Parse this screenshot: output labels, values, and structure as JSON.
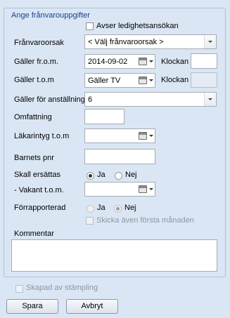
{
  "group_title": "Ange frånvarouppgifter",
  "avser_ledighet": {
    "label": "Avser ledighetsansökan",
    "checked": false
  },
  "franvaroorsak": {
    "label": "Frånvaroorsak",
    "value": "< Välj frånvaroorsak >"
  },
  "galler_from": {
    "label": "Gäller fr.o.m.",
    "value": "2014-09-02",
    "time_label": "Klockan",
    "time_value": ""
  },
  "galler_tom": {
    "label": "Gäller t.o.m",
    "value": "Gäller TV",
    "time_label": "Klockan",
    "time_value": ""
  },
  "galler_anstallning": {
    "label": "Gäller för anställning",
    "value": "6"
  },
  "omfattning": {
    "label": "Omfattning",
    "value": ""
  },
  "lakarintyg": {
    "label": "Läkarintyg t.o.m",
    "value": ""
  },
  "barnets_pnr": {
    "label": "Barnets pnr",
    "value": ""
  },
  "skall_ersattas": {
    "label": "Skall ersättas",
    "yes": "Ja",
    "no": "Nej",
    "selected": "Ja"
  },
  "vakant_tom": {
    "label": "- Vakant t.o.m.",
    "value": ""
  },
  "forrapporterad": {
    "label": "Förrapporterad",
    "yes": "Ja",
    "no": "Nej",
    "selected": "Nej"
  },
  "skicka_forsta": {
    "label": "Skicka även första månaden",
    "checked": false
  },
  "kommentar": {
    "label": "Kommentar",
    "value": ""
  },
  "skapad_stampling": {
    "label": "Skapad av stämpling",
    "checked": false
  },
  "buttons": {
    "save": "Spara",
    "cancel": "Avbryt"
  }
}
